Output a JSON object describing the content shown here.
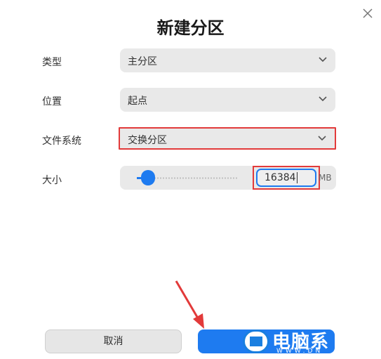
{
  "dialog": {
    "title": "新建分区",
    "close_icon": "close-icon"
  },
  "fields": {
    "type": {
      "label": "类型",
      "value": "主分区"
    },
    "position": {
      "label": "位置",
      "value": "起点"
    },
    "filesystem": {
      "label": "文件系统",
      "value": "交换分区"
    },
    "size": {
      "label": "大小",
      "value": "16384",
      "unit": "MB",
      "slider_fraction": 0.1
    }
  },
  "buttons": {
    "cancel": "取消"
  },
  "watermark": {
    "text": "电脑系",
    "sub": "WWW.DN"
  },
  "colors": {
    "accent": "#1e7bf0",
    "highlight": "#e23a3a",
    "field_bg": "#e9e9e9"
  }
}
